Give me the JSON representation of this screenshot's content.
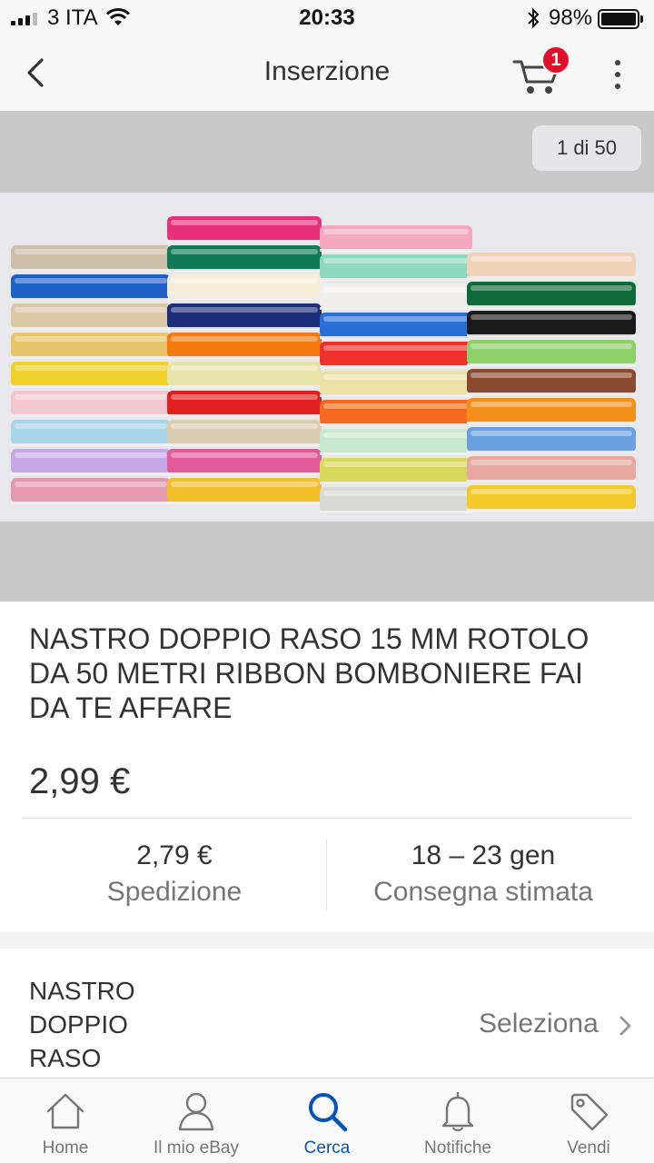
{
  "status_bar": {
    "carrier": "3 ITA",
    "time": "20:33",
    "battery": "98%"
  },
  "nav": {
    "title": "Inserzione",
    "cart_count": "1"
  },
  "gallery": {
    "counter": "1 di 50"
  },
  "listing": {
    "title": "NASTRO DOPPIO RASO 15 MM ROTOLO DA 50 METRI RIBBON BOMBONIERE FAI DA TE AFFARE",
    "price": "2,99 €",
    "shipping_value": "2,79 €",
    "shipping_label": "Spedizione",
    "delivery_value": "18 – 23 gen",
    "delivery_label": "Consegna stimata"
  },
  "variant": {
    "name": "NASTRO DOPPIO RASO",
    "action": "Seleziona"
  },
  "tabs": [
    {
      "label": "Home",
      "icon": "home-icon"
    },
    {
      "label": "Il mio eBay",
      "icon": "person-icon"
    },
    {
      "label": "Cerca",
      "icon": "search-icon"
    },
    {
      "label": "Notifiche",
      "icon": "bell-icon"
    },
    {
      "label": "Vendi",
      "icon": "tag-icon"
    }
  ],
  "colors": {
    "accent": "#0654ba",
    "badge": "#e0102a"
  }
}
